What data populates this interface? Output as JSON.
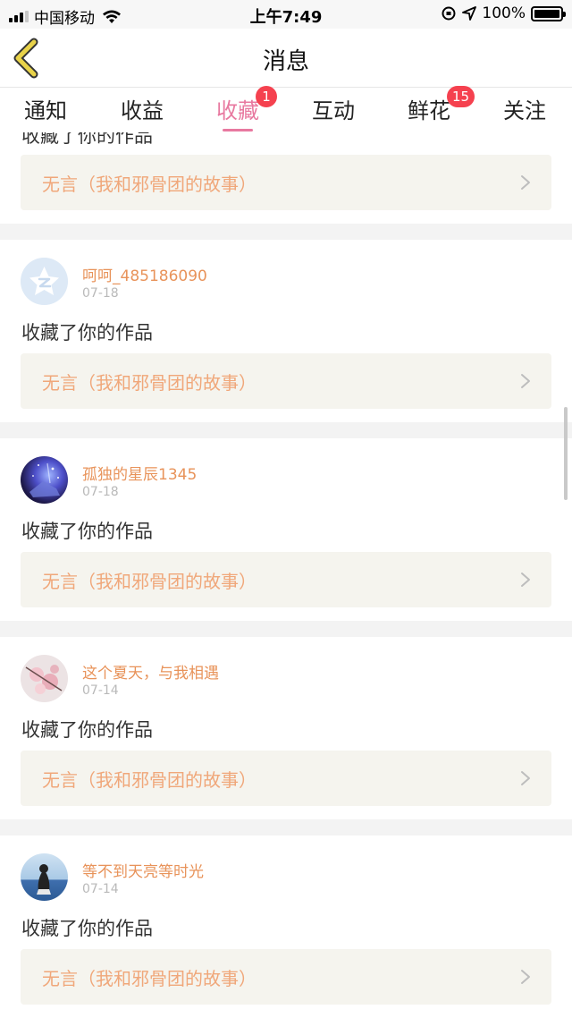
{
  "status_bar": {
    "carrier": "中国移动",
    "time": "上午7:49",
    "battery": "100%"
  },
  "nav": {
    "title": "消息",
    "back_icon": "chevron-left-icon"
  },
  "tabs": [
    {
      "label": "通知",
      "active": false,
      "badge": ""
    },
    {
      "label": "收益",
      "active": false,
      "badge": ""
    },
    {
      "label": "收藏",
      "active": true,
      "badge": "1"
    },
    {
      "label": "互动",
      "active": false,
      "badge": ""
    },
    {
      "label": "鲜花",
      "active": false,
      "badge": "15"
    },
    {
      "label": "关注",
      "active": false,
      "badge": ""
    }
  ],
  "feed": {
    "partial_top": {
      "action": "收藏了你的作品",
      "work_title": "无言（我和邪骨团的故事）"
    },
    "items": [
      {
        "username": "呵呵_485186090",
        "date": "07-18",
        "action": "收藏了你的作品",
        "work_title": "无言（我和邪骨团的故事）"
      },
      {
        "username": "孤独的星辰1345",
        "date": "07-18",
        "action": "收藏了你的作品",
        "work_title": "无言（我和邪骨团的故事）"
      },
      {
        "username": "这个夏天，与我相遇",
        "date": "07-14",
        "action": "收藏了你的作品",
        "work_title": "无言（我和邪骨团的故事）"
      },
      {
        "username": "等不到天亮等时光",
        "date": "07-14",
        "action": "收藏了你的作品",
        "work_title": "无言（我和邪骨团的故事）"
      }
    ]
  },
  "colors": {
    "accent_pink": "#e879a0",
    "badge_red": "#f5414f",
    "username_orange": "#e8935a",
    "work_title_orange": "#f0a77a",
    "work_box_bg": "#f5f4ee",
    "back_arrow": "#e9d34a"
  }
}
